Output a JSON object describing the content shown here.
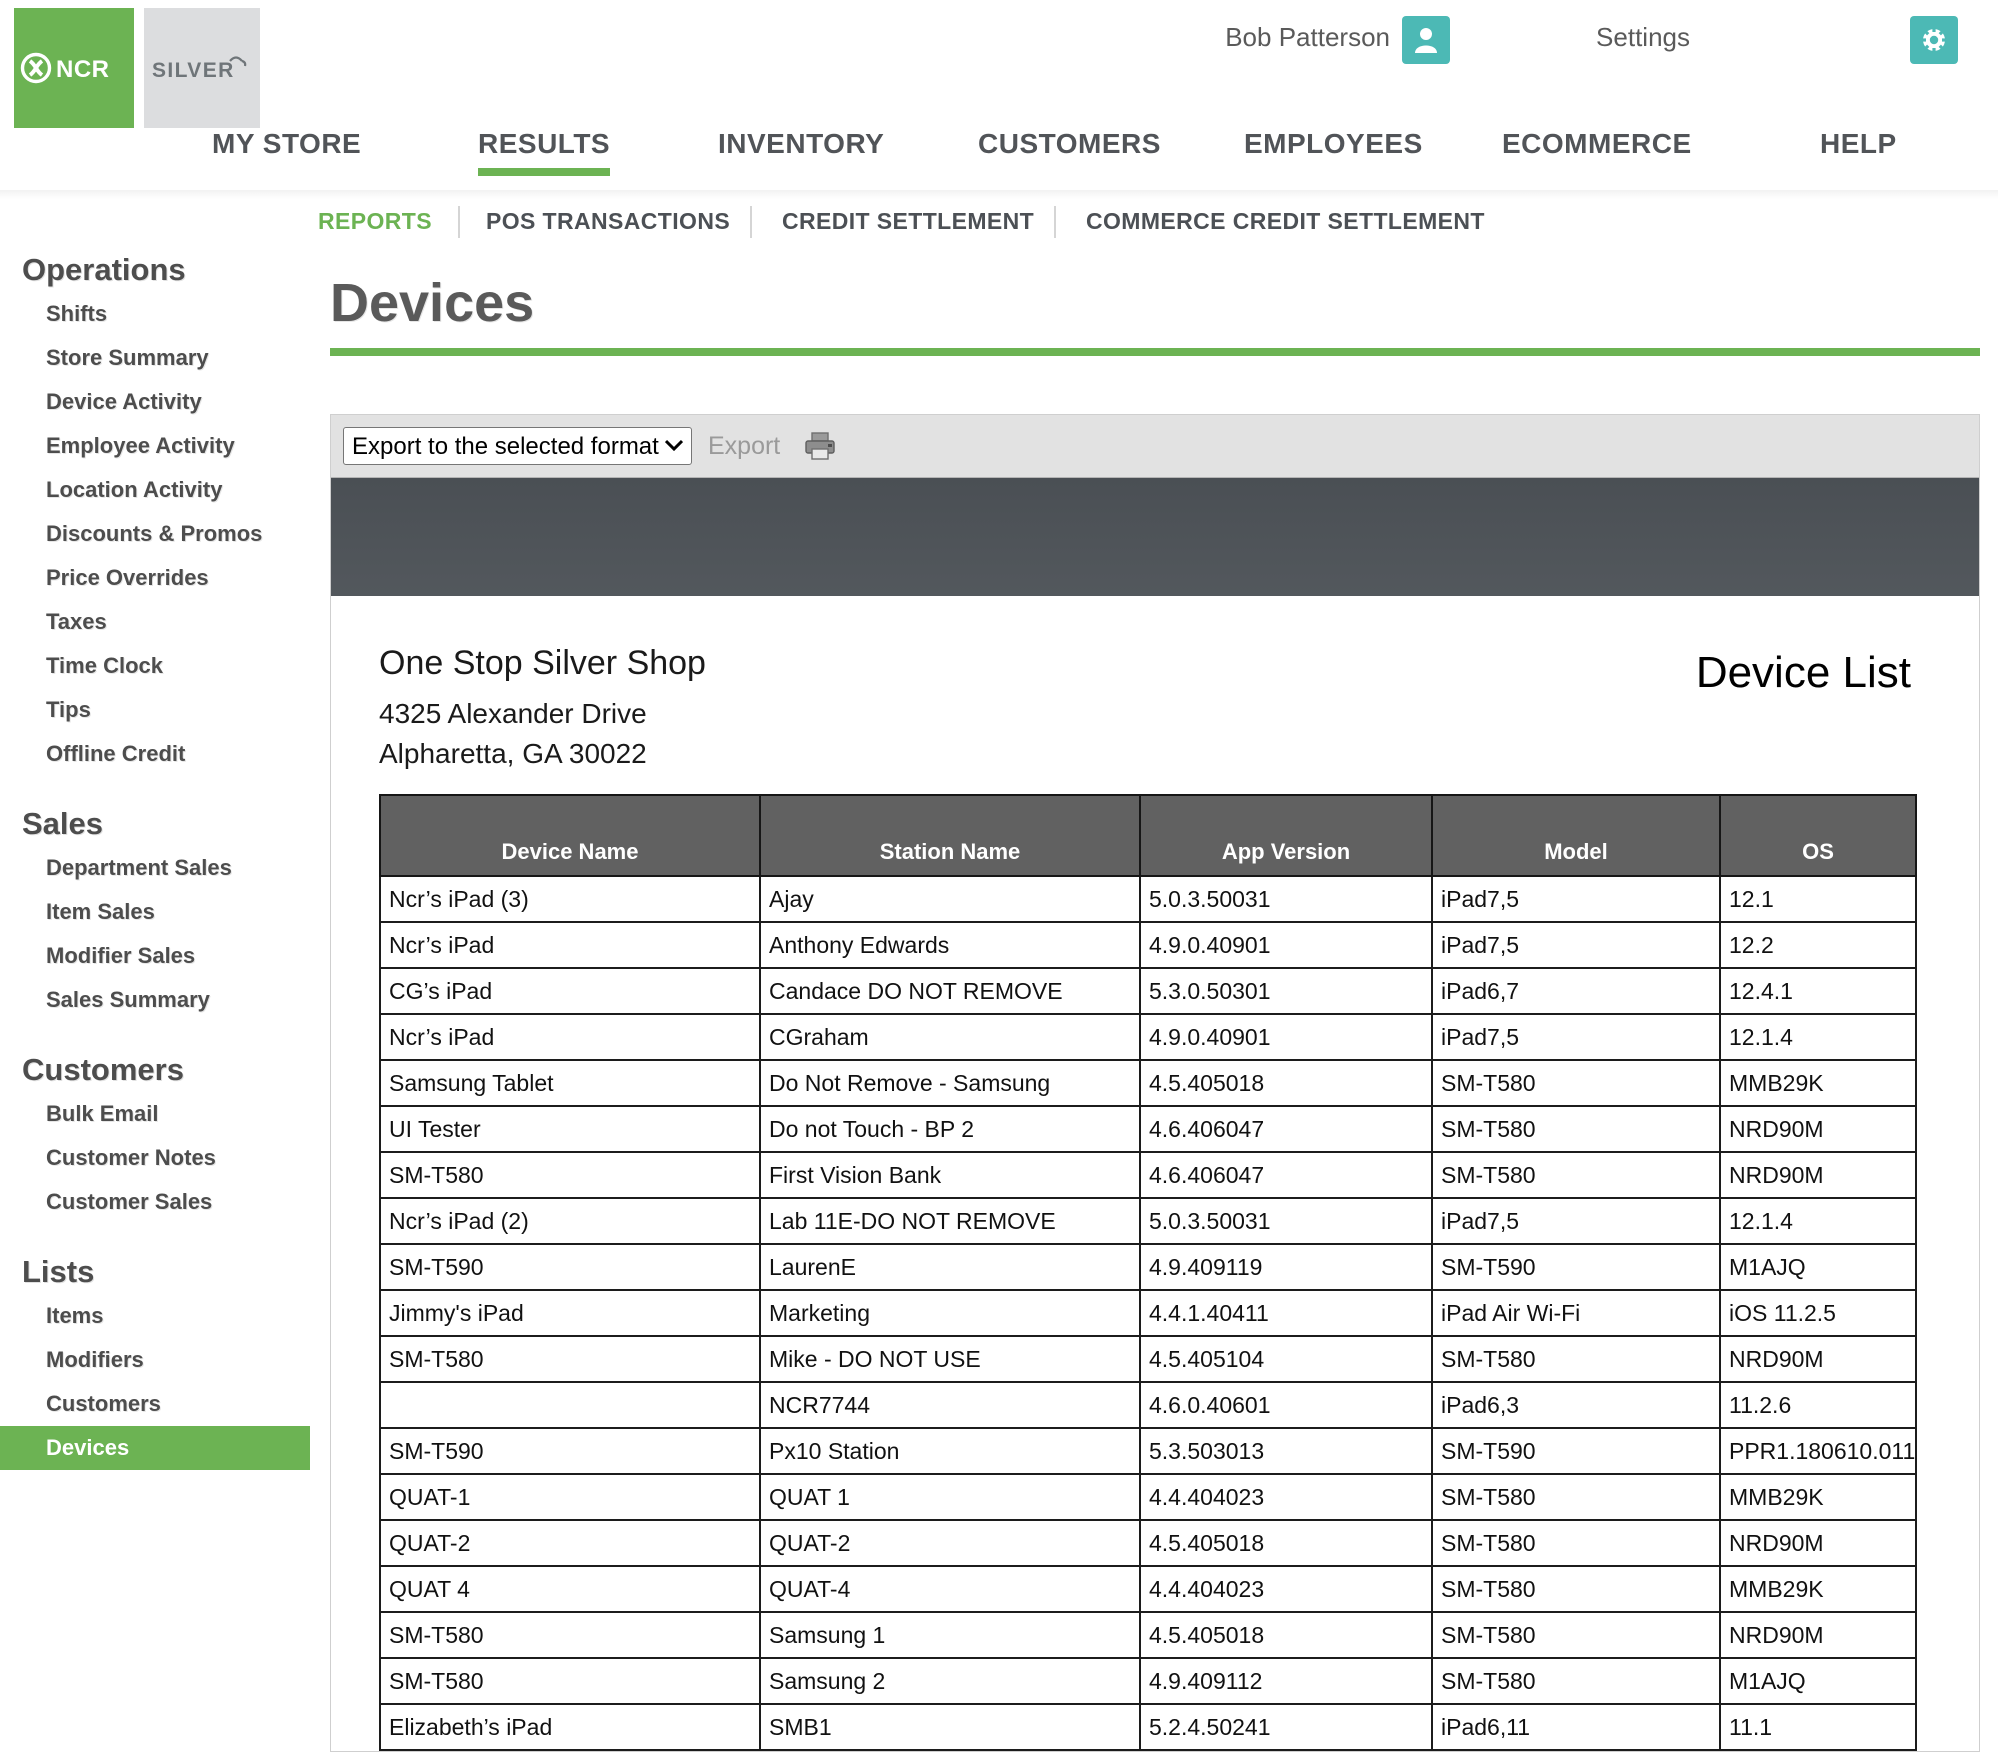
{
  "header": {
    "logo_primary": "ncr-logo",
    "logo_secondary": "SILVER",
    "user_name": "Bob Patterson",
    "user_icon": "user-avatar-icon",
    "settings_label": "Settings",
    "settings_icon": "gear-icon"
  },
  "main_nav": {
    "items": [
      {
        "label": "MY STORE",
        "active": false
      },
      {
        "label": "RESULTS",
        "active": true
      },
      {
        "label": "INVENTORY",
        "active": false
      },
      {
        "label": "CUSTOMERS",
        "active": false
      },
      {
        "label": "EMPLOYEES",
        "active": false
      },
      {
        "label": "ECOMMERCE",
        "active": false
      },
      {
        "label": "HELP",
        "active": false
      }
    ]
  },
  "sub_nav": {
    "items": [
      {
        "label": "REPORTS",
        "active": true
      },
      {
        "label": "POS TRANSACTIONS",
        "active": false
      },
      {
        "label": "CREDIT SETTLEMENT",
        "active": false
      },
      {
        "label": "COMMERCE CREDIT SETTLEMENT",
        "active": false
      }
    ]
  },
  "sidebar": {
    "groups": [
      {
        "title": "Operations",
        "links": [
          {
            "label": "Shifts",
            "active": false
          },
          {
            "label": "Store Summary",
            "active": false
          },
          {
            "label": "Device Activity",
            "active": false
          },
          {
            "label": "Employee Activity",
            "active": false
          },
          {
            "label": "Location Activity",
            "active": false
          },
          {
            "label": "Discounts & Promos",
            "active": false
          },
          {
            "label": "Price Overrides",
            "active": false
          },
          {
            "label": "Taxes",
            "active": false
          },
          {
            "label": "Time Clock",
            "active": false
          },
          {
            "label": "Tips",
            "active": false
          },
          {
            "label": "Offline Credit",
            "active": false
          }
        ]
      },
      {
        "title": "Sales",
        "links": [
          {
            "label": "Department Sales",
            "active": false
          },
          {
            "label": "Item Sales",
            "active": false
          },
          {
            "label": "Modifier Sales",
            "active": false
          },
          {
            "label": "Sales Summary",
            "active": false
          }
        ]
      },
      {
        "title": "Customers",
        "links": [
          {
            "label": "Bulk Email",
            "active": false
          },
          {
            "label": "Customer Notes",
            "active": false
          },
          {
            "label": "Customer Sales",
            "active": false
          }
        ]
      },
      {
        "title": "Lists",
        "links": [
          {
            "label": "Items",
            "active": false
          },
          {
            "label": "Modifiers",
            "active": false
          },
          {
            "label": "Customers",
            "active": false
          },
          {
            "label": "Devices",
            "active": true
          }
        ]
      }
    ]
  },
  "page": {
    "title": "Devices"
  },
  "toolbar": {
    "export_select_value": "Export to the selected format",
    "export_select_options": [
      "Export to the selected format"
    ],
    "export_label": "Export",
    "print_icon": "printer-icon",
    "caret_icon": "chevron-down-icon"
  },
  "report": {
    "store_name": "One Stop Silver Shop",
    "address_line1": "4325 Alexander Drive",
    "address_line2": "Alpharetta, GA 30022",
    "report_title": "Device List",
    "columns": [
      "Device Name",
      "Station Name",
      "App Version",
      "Model",
      "OS"
    ],
    "rows": [
      [
        "Ncr’s iPad (3)",
        "Ajay",
        "5.0.3.50031",
        "iPad7,5",
        "12.1"
      ],
      [
        "Ncr’s iPad",
        "Anthony Edwards",
        "4.9.0.40901",
        "iPad7,5",
        "12.2"
      ],
      [
        "CG’s iPad",
        "Candace DO NOT REMOVE",
        "5.3.0.50301",
        "iPad6,7",
        "12.4.1"
      ],
      [
        "Ncr’s iPad",
        "CGraham",
        "4.9.0.40901",
        "iPad7,5",
        "12.1.4"
      ],
      [
        "Samsung Tablet",
        "Do Not Remove - Samsung",
        "4.5.405018",
        "SM-T580",
        "MMB29K"
      ],
      [
        "UI Tester",
        "Do not Touch - BP 2",
        "4.6.406047",
        "SM-T580",
        "NRD90M"
      ],
      [
        "SM-T580",
        "First Vision Bank",
        "4.6.406047",
        "SM-T580",
        "NRD90M"
      ],
      [
        "Ncr’s iPad (2)",
        "Lab 11E-DO NOT REMOVE",
        "5.0.3.50031",
        "iPad7,5",
        "12.1.4"
      ],
      [
        "SM-T590",
        "LaurenE",
        "4.9.409119",
        "SM-T590",
        "M1AJQ"
      ],
      [
        "Jimmy's iPad",
        "Marketing",
        "4.4.1.40411",
        "iPad Air Wi-Fi",
        "iOS 11.2.5"
      ],
      [
        "SM-T580",
        "Mike - DO NOT USE",
        "4.5.405104",
        "SM-T580",
        "NRD90M"
      ],
      [
        "",
        "NCR7744",
        "4.6.0.40601",
        "iPad6,3",
        "11.2.6"
      ],
      [
        "SM-T590",
        "Px10 Station",
        "5.3.503013",
        "SM-T590",
        "PPR1.180610.011"
      ],
      [
        "QUAT-1",
        "QUAT 1",
        "4.4.404023",
        "SM-T580",
        "MMB29K"
      ],
      [
        "QUAT-2",
        "QUAT-2",
        "4.5.405018",
        "SM-T580",
        "NRD90M"
      ],
      [
        "QUAT 4",
        "QUAT-4",
        "4.4.404023",
        "SM-T580",
        "MMB29K"
      ],
      [
        "SM-T580",
        "Samsung 1",
        "4.5.405018",
        "SM-T580",
        "NRD90M"
      ],
      [
        "SM-T580",
        "Samsung 2",
        "4.9.409112",
        "SM-T580",
        "M1AJQ"
      ],
      [
        "Elizabeth’s iPad",
        "SMB1",
        "5.2.4.50241",
        "iPad6,11",
        "11.1"
      ]
    ]
  },
  "colors": {
    "brand_green": "#6cb353",
    "accent_teal": "#4cb9b5",
    "dark_band": "#50555a",
    "table_header": "#616161"
  }
}
